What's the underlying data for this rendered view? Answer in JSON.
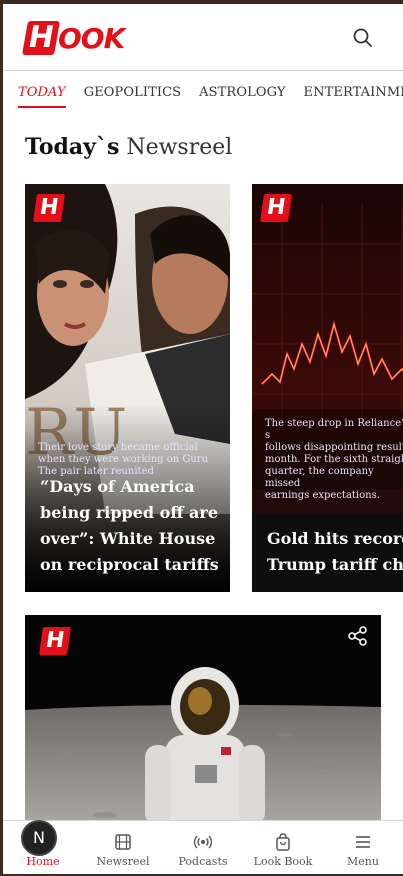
{
  "header": {
    "logo_letter": "H",
    "logo_text": "OOK"
  },
  "tabs": [
    {
      "label": "TODAY",
      "active": true
    },
    {
      "label": "GEOPOLITICS",
      "active": false
    },
    {
      "label": "ASTROLOGY",
      "active": false
    },
    {
      "label": "ENTERTAINMENT",
      "active": false
    }
  ],
  "section": {
    "title_bold": "Today`s",
    "title_light": "Newsreel"
  },
  "cards": [
    {
      "badge": "H",
      "overlay_line1": "Their love story became official",
      "overlay_line2": "when they were working on Guru",
      "overlay_line3": "The pair later reunited",
      "title": "“Days of America being ripped off are over”: White House on reciprocal tariffs"
    },
    {
      "badge": "H",
      "overlay_line1": "The steep drop in Reliance’s s",
      "overlay_line2": "follows disappointing results",
      "overlay_line3": "month. For the sixth straight",
      "overlay_line4": "quarter, the company missed",
      "overlay_line5": "earnings expectations.",
      "title": "Gold hits record a Trump tariff chac"
    },
    {
      "badge": "H"
    }
  ],
  "bottom_nav": [
    {
      "label": "Home",
      "icon": "home-icon",
      "active": true
    },
    {
      "label": "Newsreel",
      "icon": "film-icon",
      "active": false
    },
    {
      "label": "Podcasts",
      "icon": "broadcast-icon",
      "active": false
    },
    {
      "label": "Look Book",
      "icon": "shopping-bag-icon",
      "active": false
    },
    {
      "label": "Menu",
      "icon": "menu-icon",
      "active": false
    }
  ],
  "fab": {
    "label": "N"
  },
  "colors": {
    "brand": "#e3101a",
    "text": "#111111"
  }
}
